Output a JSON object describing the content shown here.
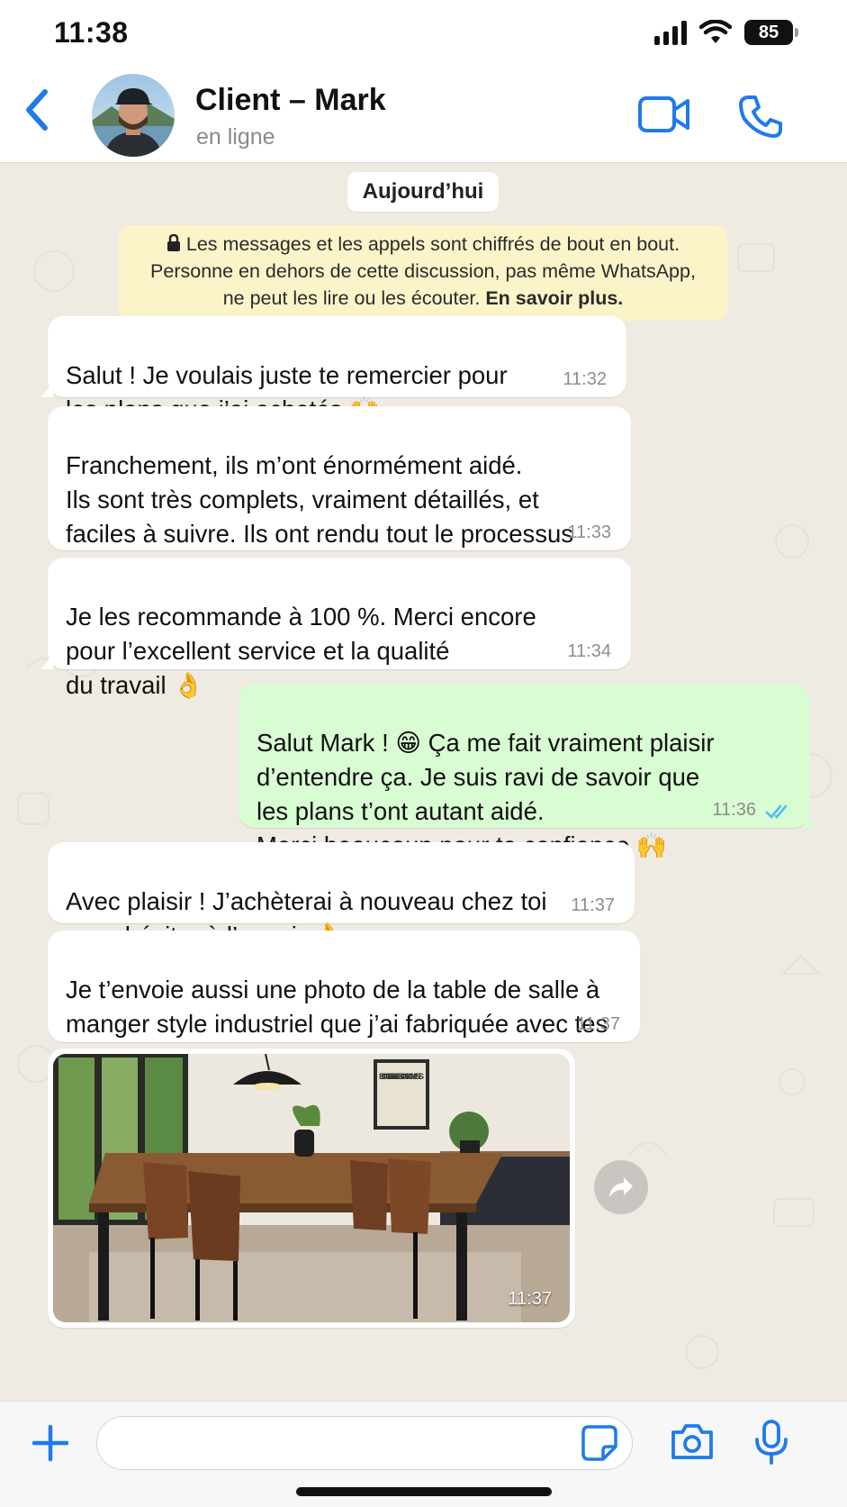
{
  "status_bar": {
    "time": "11:38",
    "battery": "85"
  },
  "header": {
    "contact_name": "Client – Mark",
    "contact_status": "en ligne",
    "icons": [
      "back-chevron-icon",
      "video-call-icon",
      "phone-call-icon"
    ]
  },
  "chat": {
    "date_label": "Aujourd’hui",
    "encryption": {
      "line1": "Les messages et les appels sont chiffrés de bout en bout.",
      "line2": "Personne en dehors de cette discussion, pas même WhatsApp,",
      "line3": "ne peut les lire ou les écouter.",
      "link": "En savoir plus."
    },
    "messages": [
      {
        "dir": "in",
        "text": "Salut ! Je voulais juste te remercier pour\nles plans que j’ai achetés 🙌",
        "time": "11:32"
      },
      {
        "dir": "in",
        "text": "Franchement, ils m’ont énormément aidé.\nIls sont très complets, vraiment détaillés, et\nfaciles à suivre. Ils ont rendu tout le processus\nde fabrication beaucoup plus simple.",
        "time": "11:33"
      },
      {
        "dir": "in",
        "text": "Je les recommande à 100 %. Merci encore\npour l’excellent service et la qualité\ndu travail 👌",
        "time": "11:34"
      },
      {
        "dir": "out",
        "text": "Salut Mark ! 😁 Ça me fait vraiment plaisir\nd’entendre ça. Je suis ravi de savoir que\nles plans t’ont autant aidé.\nMerci beaucoup pour ta confiance 🙌",
        "time": "11:36",
        "status": "read"
      },
      {
        "dir": "in",
        "text": "Avec plaisir ! J’achèterai à nouveau chez toi\nsans hésiter à l’avenir 👌",
        "time": "11:37"
      },
      {
        "dir": "in",
        "text": "Je t’envoie aussi une photo de la table de salle à\nmanger style industriel que j’ai fabriquée avec tes\nplans. Le rendu est top !",
        "time": "11:37"
      }
    ],
    "photo": {
      "time": "11:37",
      "poster_text": "BONNES TABLES BONS MOMENTS"
    }
  },
  "composer": {
    "placeholder": ""
  },
  "colors": {
    "accent": "#1f7aec",
    "outgoing": "#d9fdd3",
    "incoming": "#ffffff",
    "read_ticks": "#53bdeb",
    "chat_bg": "#efeae2",
    "encryption_bg": "#fcf4c9"
  }
}
